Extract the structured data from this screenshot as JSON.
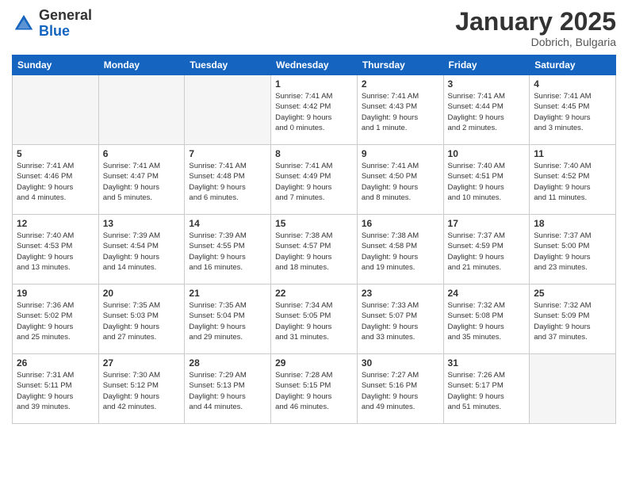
{
  "header": {
    "logo_general": "General",
    "logo_blue": "Blue",
    "month": "January 2025",
    "location": "Dobrich, Bulgaria"
  },
  "weekdays": [
    "Sunday",
    "Monday",
    "Tuesday",
    "Wednesday",
    "Thursday",
    "Friday",
    "Saturday"
  ],
  "weeks": [
    [
      {
        "day": "",
        "info": ""
      },
      {
        "day": "",
        "info": ""
      },
      {
        "day": "",
        "info": ""
      },
      {
        "day": "1",
        "info": "Sunrise: 7:41 AM\nSunset: 4:42 PM\nDaylight: 9 hours\nand 0 minutes."
      },
      {
        "day": "2",
        "info": "Sunrise: 7:41 AM\nSunset: 4:43 PM\nDaylight: 9 hours\nand 1 minute."
      },
      {
        "day": "3",
        "info": "Sunrise: 7:41 AM\nSunset: 4:44 PM\nDaylight: 9 hours\nand 2 minutes."
      },
      {
        "day": "4",
        "info": "Sunrise: 7:41 AM\nSunset: 4:45 PM\nDaylight: 9 hours\nand 3 minutes."
      }
    ],
    [
      {
        "day": "5",
        "info": "Sunrise: 7:41 AM\nSunset: 4:46 PM\nDaylight: 9 hours\nand 4 minutes."
      },
      {
        "day": "6",
        "info": "Sunrise: 7:41 AM\nSunset: 4:47 PM\nDaylight: 9 hours\nand 5 minutes."
      },
      {
        "day": "7",
        "info": "Sunrise: 7:41 AM\nSunset: 4:48 PM\nDaylight: 9 hours\nand 6 minutes."
      },
      {
        "day": "8",
        "info": "Sunrise: 7:41 AM\nSunset: 4:49 PM\nDaylight: 9 hours\nand 7 minutes."
      },
      {
        "day": "9",
        "info": "Sunrise: 7:41 AM\nSunset: 4:50 PM\nDaylight: 9 hours\nand 8 minutes."
      },
      {
        "day": "10",
        "info": "Sunrise: 7:40 AM\nSunset: 4:51 PM\nDaylight: 9 hours\nand 10 minutes."
      },
      {
        "day": "11",
        "info": "Sunrise: 7:40 AM\nSunset: 4:52 PM\nDaylight: 9 hours\nand 11 minutes."
      }
    ],
    [
      {
        "day": "12",
        "info": "Sunrise: 7:40 AM\nSunset: 4:53 PM\nDaylight: 9 hours\nand 13 minutes."
      },
      {
        "day": "13",
        "info": "Sunrise: 7:39 AM\nSunset: 4:54 PM\nDaylight: 9 hours\nand 14 minutes."
      },
      {
        "day": "14",
        "info": "Sunrise: 7:39 AM\nSunset: 4:55 PM\nDaylight: 9 hours\nand 16 minutes."
      },
      {
        "day": "15",
        "info": "Sunrise: 7:38 AM\nSunset: 4:57 PM\nDaylight: 9 hours\nand 18 minutes."
      },
      {
        "day": "16",
        "info": "Sunrise: 7:38 AM\nSunset: 4:58 PM\nDaylight: 9 hours\nand 19 minutes."
      },
      {
        "day": "17",
        "info": "Sunrise: 7:37 AM\nSunset: 4:59 PM\nDaylight: 9 hours\nand 21 minutes."
      },
      {
        "day": "18",
        "info": "Sunrise: 7:37 AM\nSunset: 5:00 PM\nDaylight: 9 hours\nand 23 minutes."
      }
    ],
    [
      {
        "day": "19",
        "info": "Sunrise: 7:36 AM\nSunset: 5:02 PM\nDaylight: 9 hours\nand 25 minutes."
      },
      {
        "day": "20",
        "info": "Sunrise: 7:35 AM\nSunset: 5:03 PM\nDaylight: 9 hours\nand 27 minutes."
      },
      {
        "day": "21",
        "info": "Sunrise: 7:35 AM\nSunset: 5:04 PM\nDaylight: 9 hours\nand 29 minutes."
      },
      {
        "day": "22",
        "info": "Sunrise: 7:34 AM\nSunset: 5:05 PM\nDaylight: 9 hours\nand 31 minutes."
      },
      {
        "day": "23",
        "info": "Sunrise: 7:33 AM\nSunset: 5:07 PM\nDaylight: 9 hours\nand 33 minutes."
      },
      {
        "day": "24",
        "info": "Sunrise: 7:32 AM\nSunset: 5:08 PM\nDaylight: 9 hours\nand 35 minutes."
      },
      {
        "day": "25",
        "info": "Sunrise: 7:32 AM\nSunset: 5:09 PM\nDaylight: 9 hours\nand 37 minutes."
      }
    ],
    [
      {
        "day": "26",
        "info": "Sunrise: 7:31 AM\nSunset: 5:11 PM\nDaylight: 9 hours\nand 39 minutes."
      },
      {
        "day": "27",
        "info": "Sunrise: 7:30 AM\nSunset: 5:12 PM\nDaylight: 9 hours\nand 42 minutes."
      },
      {
        "day": "28",
        "info": "Sunrise: 7:29 AM\nSunset: 5:13 PM\nDaylight: 9 hours\nand 44 minutes."
      },
      {
        "day": "29",
        "info": "Sunrise: 7:28 AM\nSunset: 5:15 PM\nDaylight: 9 hours\nand 46 minutes."
      },
      {
        "day": "30",
        "info": "Sunrise: 7:27 AM\nSunset: 5:16 PM\nDaylight: 9 hours\nand 49 minutes."
      },
      {
        "day": "31",
        "info": "Sunrise: 7:26 AM\nSunset: 5:17 PM\nDaylight: 9 hours\nand 51 minutes."
      },
      {
        "day": "",
        "info": ""
      }
    ]
  ]
}
